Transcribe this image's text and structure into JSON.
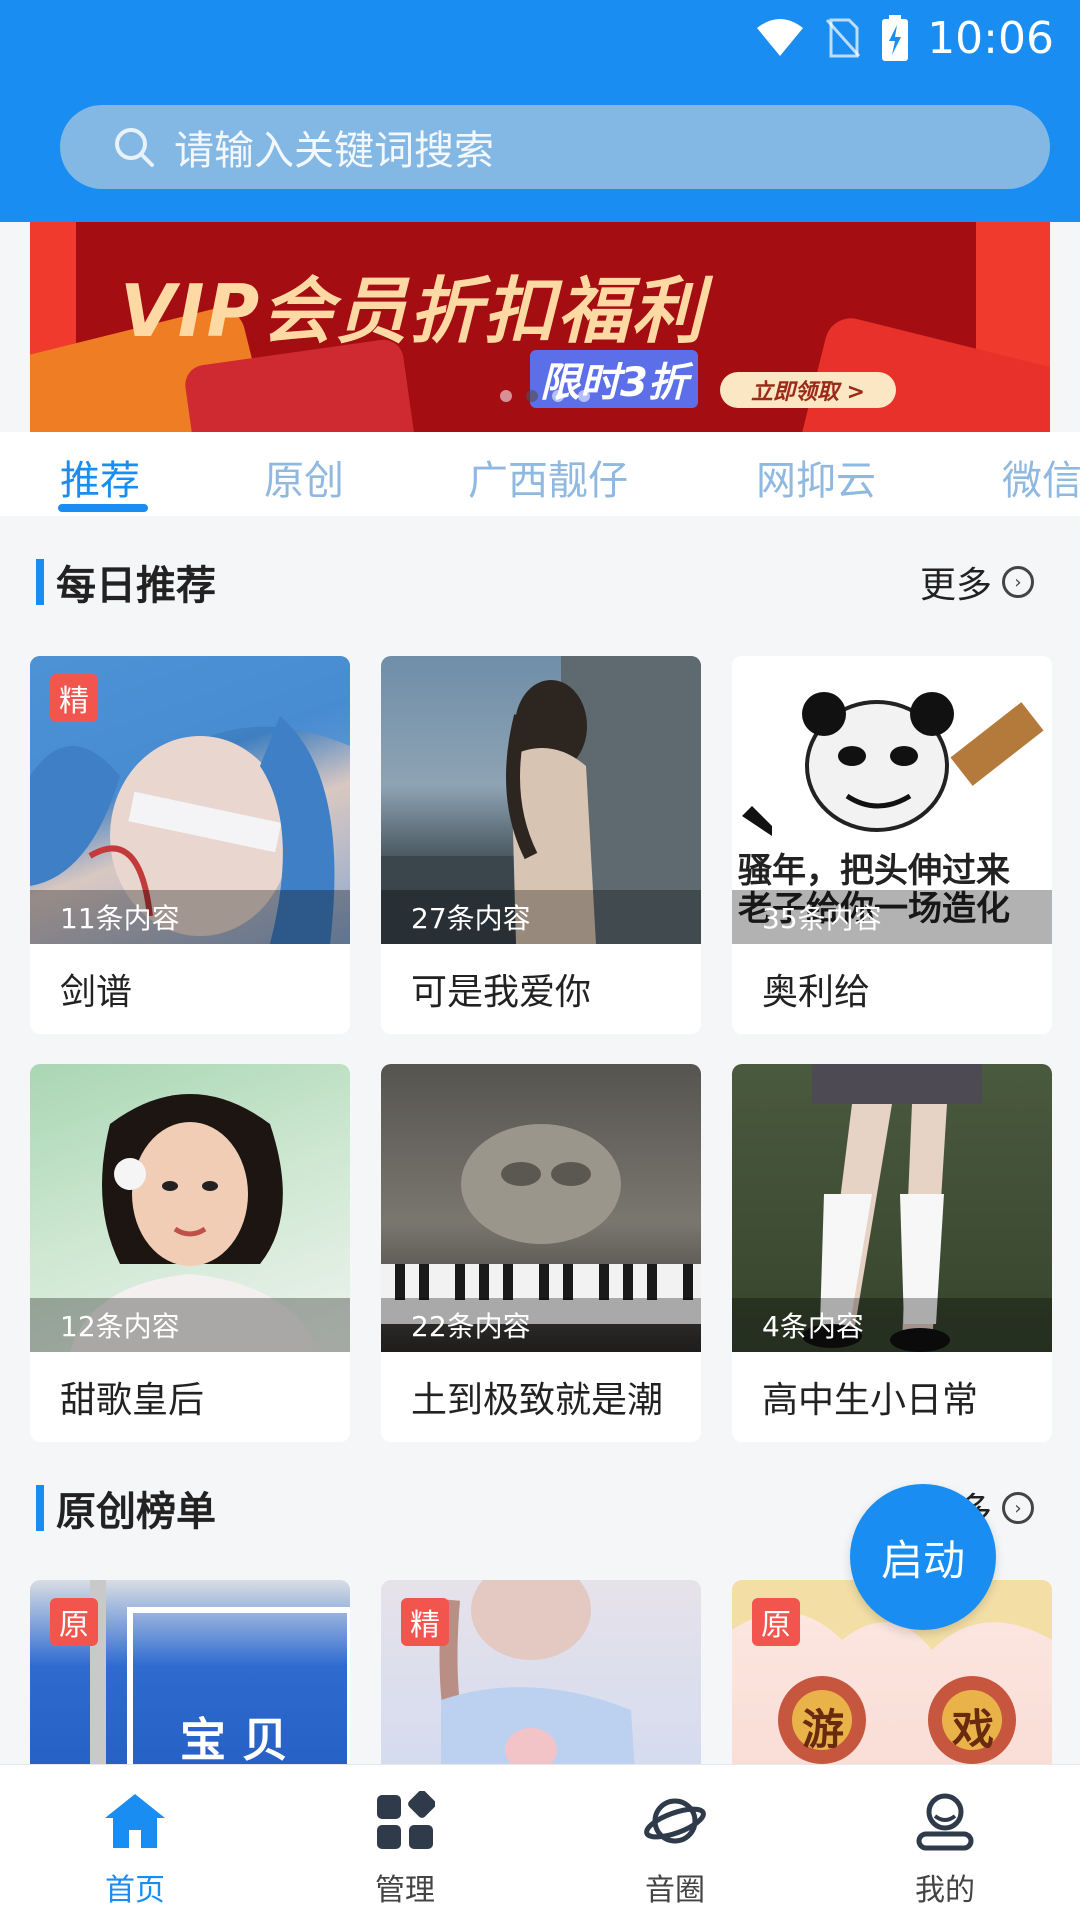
{
  "status_bar": {
    "time": "10:06"
  },
  "search": {
    "placeholder": "请输入关键词搜索"
  },
  "banner": {
    "title": "VIP会员折扣福利",
    "promo": "限时3折",
    "cta": "立即领取 >"
  },
  "tabs": [
    {
      "label": "推荐",
      "active": true
    },
    {
      "label": "原创",
      "active": false
    },
    {
      "label": "广西靓仔",
      "active": false
    },
    {
      "label": "网抑云",
      "active": false
    },
    {
      "label": "微信",
      "active": false
    }
  ],
  "daily": {
    "title": "每日推荐",
    "more": "更多",
    "cards": [
      {
        "name": "剑谱",
        "count": "11条内容",
        "badge": "精"
      },
      {
        "name": "可是我爱你",
        "count": "27条内容",
        "badge": ""
      },
      {
        "name": "奥利给",
        "count": "35条内容",
        "badge": "",
        "image_text": "骚年，把头伸过来 老子给你一场造化"
      },
      {
        "name": "甜歌皇后",
        "count": "12条内容",
        "badge": ""
      },
      {
        "name": "土到极致就是潮",
        "count": "22条内容",
        "badge": ""
      },
      {
        "name": "高中生小日常",
        "count": "4条内容",
        "badge": ""
      }
    ]
  },
  "original": {
    "title": "原创榜单",
    "more": "更多",
    "cards": [
      {
        "badge": "原",
        "image_text": "宝 贝"
      },
      {
        "badge": "精"
      },
      {
        "badge": "原",
        "image_text_left": "游",
        "image_text_right": "戏"
      }
    ]
  },
  "fab": {
    "label": "启动"
  },
  "nav": [
    {
      "label": "首页",
      "icon": "home-icon",
      "active": true
    },
    {
      "label": "管理",
      "icon": "grid-icon",
      "active": false
    },
    {
      "label": "音圈",
      "icon": "planet-icon",
      "active": false
    },
    {
      "label": "我的",
      "icon": "user-icon",
      "active": false
    }
  ],
  "colors": {
    "primary": "#1a8df2",
    "badge": "#f2554e"
  }
}
